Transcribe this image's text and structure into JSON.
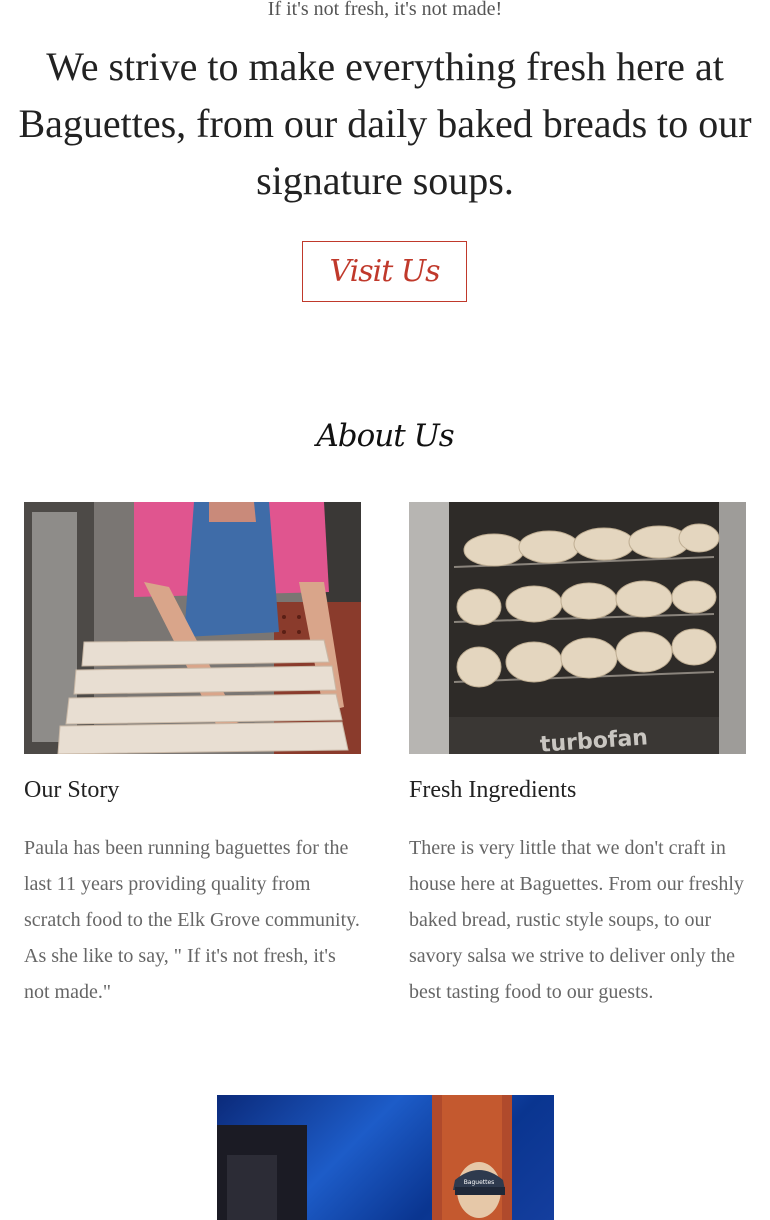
{
  "hero": {
    "tagline": "If it's not fresh, it's not made!",
    "headline": "We strive to make everything fresh here at Baguettes, from our daily baked breads to our signature soups.",
    "cta_label": "Visit Us"
  },
  "about": {
    "title": "About Us",
    "columns": [
      {
        "heading": "Our Story",
        "paragraph1": "Paula has been running baguettes for the last 11 years providing quality from scratch food to the Elk Grove community.",
        "paragraph2": "As she like to say, \" If it's not fresh, it's not made.\""
      },
      {
        "heading": "Fresh Ingredients",
        "paragraph1": "There is very little that we don't craft in house here at Baguettes. From our freshly baked bread, rustic style soups, to our savory salsa we strive to deliver only the best tasting food to our guests."
      }
    ]
  },
  "images": {
    "oven_brand": "turbofan",
    "cap_logo": "Baguettes"
  },
  "colors": {
    "accent": "#c0392b",
    "heading_text": "#222222",
    "body_text": "#666666"
  }
}
